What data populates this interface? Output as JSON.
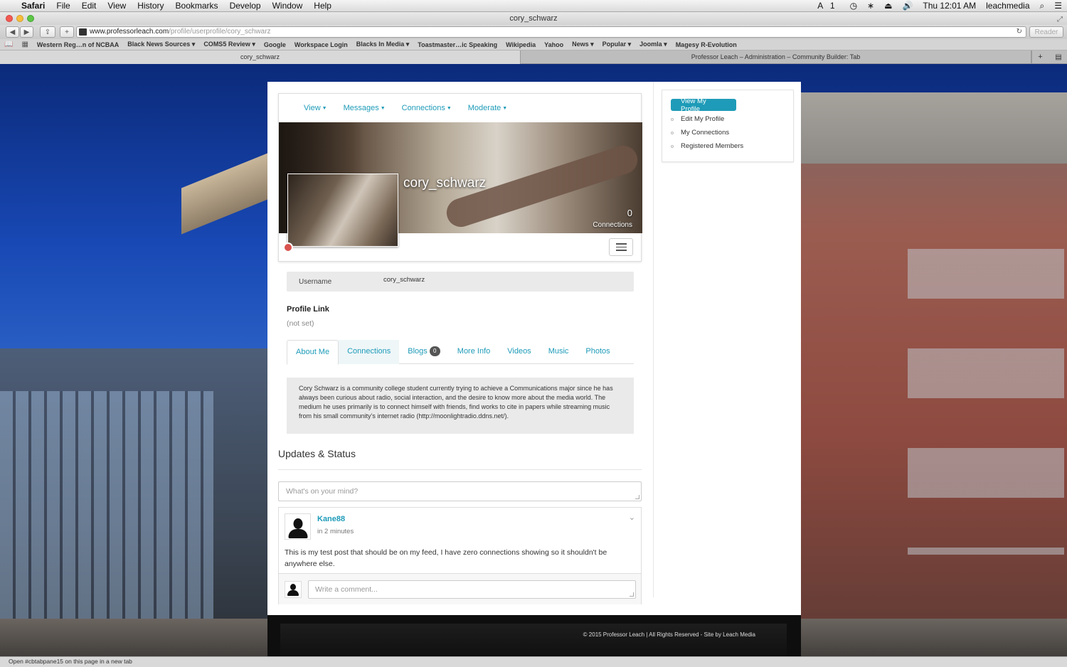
{
  "menubar": {
    "app": "Safari",
    "items": [
      "File",
      "Edit",
      "View",
      "History",
      "Bookmarks",
      "Develop",
      "Window",
      "Help"
    ],
    "status_right": {
      "accessibility": "1",
      "clock": "Thu 12:01 AM",
      "user": "leachmedia"
    }
  },
  "window": {
    "title": "cory_schwarz"
  },
  "toolbar": {
    "url_host": "www.professorleach.com",
    "url_path": "/profile/userprofile/cory_schwarz",
    "reader": "Reader"
  },
  "bookmarks": [
    "Western Reg…n of NCBAA",
    "Black News Sources ▾",
    "COMS5 Review ▾",
    "Google",
    "Workspace Login",
    "Blacks In Media ▾",
    "Toastmaster…ic Speaking",
    "Wikipedia",
    "Yahoo",
    "News ▾",
    "Popular ▾",
    "Joomla ▾",
    "Magesy R-Evolution"
  ],
  "tabs": [
    "cory_schwarz",
    "Professor Leach – Administration – Community Builder: Tab"
  ],
  "profile": {
    "nav": [
      "View",
      "Messages",
      "Connections",
      "Moderate"
    ],
    "display_name": "cory_schwarz",
    "connections_count": "0",
    "connections_label": "Connections",
    "username_label": "Username",
    "username_value": "cory_schwarz",
    "profile_link_title": "Profile Link",
    "profile_link_value": "(not set)",
    "tabs": [
      "About Me",
      "Connections",
      "Blogs",
      "More Info",
      "Videos",
      "Music",
      "Photos"
    ],
    "blogs_badge": "0",
    "about_text": "Cory Schwarz is a community college student currently trying to achieve a Communications major since he has always been curious about radio, social interaction, and the desire to know more about the media world. The medium he uses primarily is to connect himself with friends, find works to cite in papers while streaming music from his small community’s internet radio (http://moonlightradio.ddns.net/).",
    "colors": {
      "accent": "#1e9bb8",
      "status_offline": "#d9534f"
    }
  },
  "updates": {
    "title": "Updates & Status",
    "status_placeholder": "What's on your mind?",
    "post": {
      "author": "Kane88",
      "time": "in 2 minutes",
      "text": "This is my test post that should be on my feed, I have zero connections showing so it shouldn't be anywhere else."
    },
    "comment_placeholder": "Write a comment..."
  },
  "sidebar": {
    "items": [
      "View My Profile",
      "Edit My Profile",
      "My Connections",
      "Registered Members"
    ]
  },
  "footer": {
    "text": "© 2015 Professor Leach | All Rights Reserved - Site by Leach Media"
  },
  "statusbar": {
    "text": "Open #cbtabpane15 on this page in a new tab"
  }
}
